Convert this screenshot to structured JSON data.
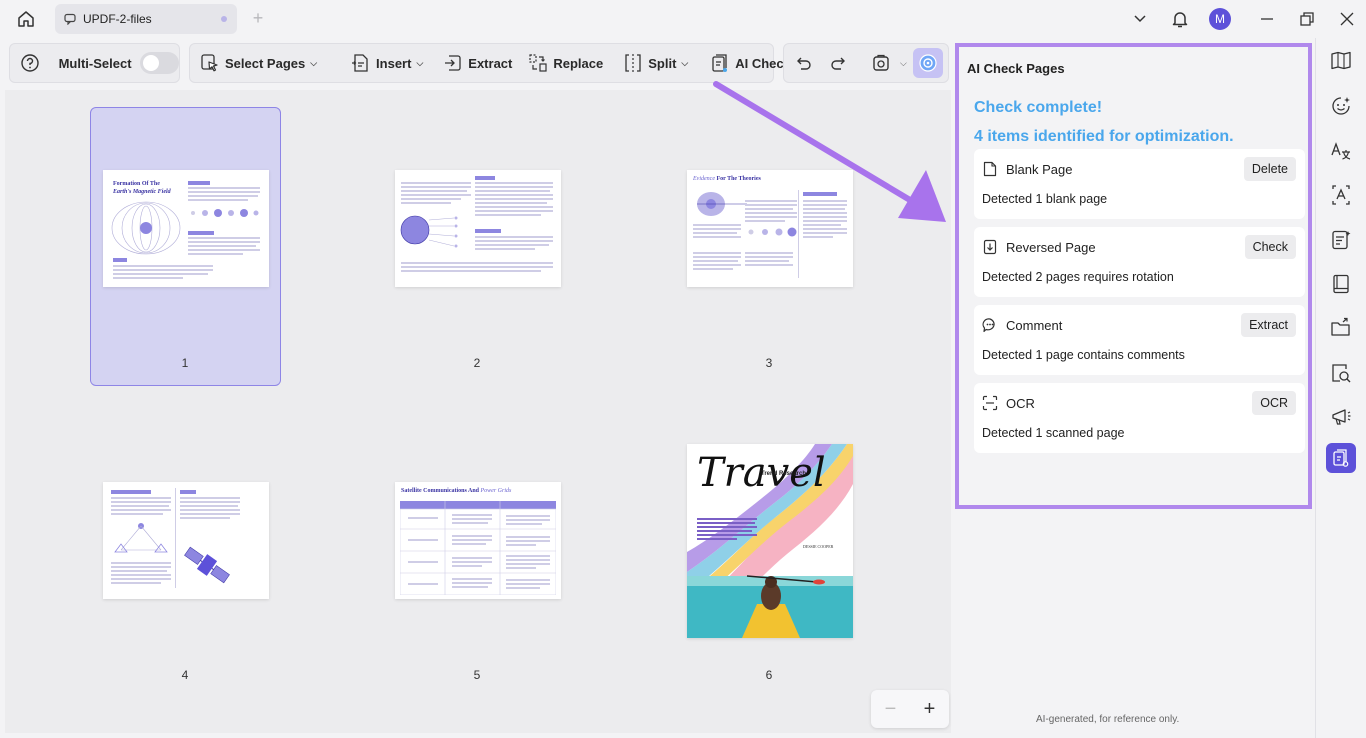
{
  "titlebar": {
    "tab_title": "UPDF-2-files",
    "avatar_letter": "M"
  },
  "toolbar": {
    "multi_select_label": "Multi-Select",
    "multi_select_on": false,
    "select_pages_label": "Select Pages",
    "insert_label": "Insert",
    "extract_label": "Extract",
    "replace_label": "Replace",
    "split_label": "Split",
    "ai_check_label": "AI Check"
  },
  "pages": [
    {
      "number": "1",
      "selected": true
    },
    {
      "number": "2",
      "selected": false
    },
    {
      "number": "3",
      "selected": false
    },
    {
      "number": "4",
      "selected": false
    },
    {
      "number": "5",
      "selected": false
    },
    {
      "number": "6",
      "selected": false
    }
  ],
  "thumb_text": {
    "p1_title_a": "Formation Of The",
    "p1_title_b": "Earth's Magnetic Field",
    "p3_title_a": "Evidence",
    "p3_title_b": " For The Theories",
    "p5_title_a": "Satellite Communications And",
    "p5_title_b": " Power Grids",
    "p6_title": "Travel",
    "p6_subtitle": "Trend Research",
    "p6_author": "DESSIE COOPER"
  },
  "ai_panel": {
    "title": "AI Check Pages",
    "complete_line1": "Check complete!",
    "complete_line2": "4 items identified for optimization.",
    "items": [
      {
        "icon": "blank-page-icon",
        "title": "Blank Page",
        "button": "Delete",
        "description": "Detected 1 blank page"
      },
      {
        "icon": "reversed-page-icon",
        "title": "Reversed Page",
        "button": "Check",
        "description": "Detected 2 pages requires rotation"
      },
      {
        "icon": "comment-icon",
        "title": "Comment",
        "button": "Extract",
        "description": "Detected 1 page contains comments"
      },
      {
        "icon": "ocr-icon",
        "title": "OCR",
        "button": "OCR",
        "description": "Detected 1 scanned page"
      }
    ],
    "footer": "AI-generated, for reference only."
  },
  "zoom": {
    "minus": "−",
    "plus": "+"
  },
  "colors": {
    "accent": "#5d51d9",
    "highlight_border": "#b088ec",
    "check_complete": "#4aa7ec",
    "arrow": "#a873ec",
    "selected_page_bg": "#d4d3f2"
  },
  "rail_icons": [
    "reader-icon",
    "ai-assistant-icon",
    "translate-icon",
    "ocr-text-icon",
    "form-icon",
    "organize-icon",
    "export-icon",
    "search-page-icon",
    "presentation-icon",
    "ai-check-icon"
  ]
}
